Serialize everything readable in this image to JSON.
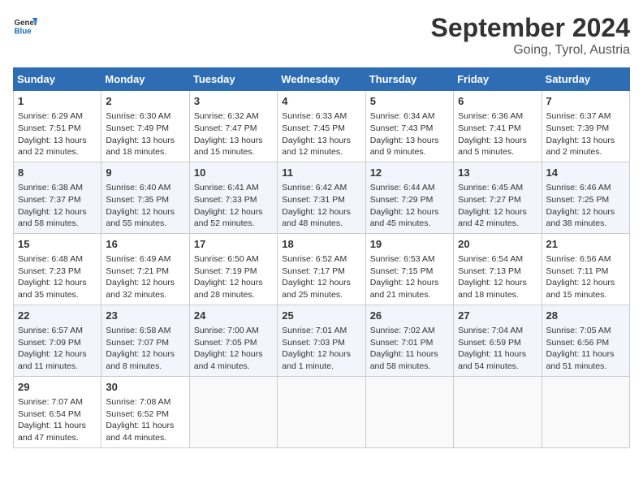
{
  "header": {
    "logo_line1": "General",
    "logo_line2": "Blue",
    "month": "September 2024",
    "location": "Going, Tyrol, Austria"
  },
  "weekdays": [
    "Sunday",
    "Monday",
    "Tuesday",
    "Wednesday",
    "Thursday",
    "Friday",
    "Saturday"
  ],
  "weeks": [
    [
      {
        "day": "1",
        "info": "Sunrise: 6:29 AM\nSunset: 7:51 PM\nDaylight: 13 hours\nand 22 minutes."
      },
      {
        "day": "2",
        "info": "Sunrise: 6:30 AM\nSunset: 7:49 PM\nDaylight: 13 hours\nand 18 minutes."
      },
      {
        "day": "3",
        "info": "Sunrise: 6:32 AM\nSunset: 7:47 PM\nDaylight: 13 hours\nand 15 minutes."
      },
      {
        "day": "4",
        "info": "Sunrise: 6:33 AM\nSunset: 7:45 PM\nDaylight: 13 hours\nand 12 minutes."
      },
      {
        "day": "5",
        "info": "Sunrise: 6:34 AM\nSunset: 7:43 PM\nDaylight: 13 hours\nand 9 minutes."
      },
      {
        "day": "6",
        "info": "Sunrise: 6:36 AM\nSunset: 7:41 PM\nDaylight: 13 hours\nand 5 minutes."
      },
      {
        "day": "7",
        "info": "Sunrise: 6:37 AM\nSunset: 7:39 PM\nDaylight: 13 hours\nand 2 minutes."
      }
    ],
    [
      {
        "day": "8",
        "info": "Sunrise: 6:38 AM\nSunset: 7:37 PM\nDaylight: 12 hours\nand 58 minutes."
      },
      {
        "day": "9",
        "info": "Sunrise: 6:40 AM\nSunset: 7:35 PM\nDaylight: 12 hours\nand 55 minutes."
      },
      {
        "day": "10",
        "info": "Sunrise: 6:41 AM\nSunset: 7:33 PM\nDaylight: 12 hours\nand 52 minutes."
      },
      {
        "day": "11",
        "info": "Sunrise: 6:42 AM\nSunset: 7:31 PM\nDaylight: 12 hours\nand 48 minutes."
      },
      {
        "day": "12",
        "info": "Sunrise: 6:44 AM\nSunset: 7:29 PM\nDaylight: 12 hours\nand 45 minutes."
      },
      {
        "day": "13",
        "info": "Sunrise: 6:45 AM\nSunset: 7:27 PM\nDaylight: 12 hours\nand 42 minutes."
      },
      {
        "day": "14",
        "info": "Sunrise: 6:46 AM\nSunset: 7:25 PM\nDaylight: 12 hours\nand 38 minutes."
      }
    ],
    [
      {
        "day": "15",
        "info": "Sunrise: 6:48 AM\nSunset: 7:23 PM\nDaylight: 12 hours\nand 35 minutes."
      },
      {
        "day": "16",
        "info": "Sunrise: 6:49 AM\nSunset: 7:21 PM\nDaylight: 12 hours\nand 32 minutes."
      },
      {
        "day": "17",
        "info": "Sunrise: 6:50 AM\nSunset: 7:19 PM\nDaylight: 12 hours\nand 28 minutes."
      },
      {
        "day": "18",
        "info": "Sunrise: 6:52 AM\nSunset: 7:17 PM\nDaylight: 12 hours\nand 25 minutes."
      },
      {
        "day": "19",
        "info": "Sunrise: 6:53 AM\nSunset: 7:15 PM\nDaylight: 12 hours\nand 21 minutes."
      },
      {
        "day": "20",
        "info": "Sunrise: 6:54 AM\nSunset: 7:13 PM\nDaylight: 12 hours\nand 18 minutes."
      },
      {
        "day": "21",
        "info": "Sunrise: 6:56 AM\nSunset: 7:11 PM\nDaylight: 12 hours\nand 15 minutes."
      }
    ],
    [
      {
        "day": "22",
        "info": "Sunrise: 6:57 AM\nSunset: 7:09 PM\nDaylight: 12 hours\nand 11 minutes."
      },
      {
        "day": "23",
        "info": "Sunrise: 6:58 AM\nSunset: 7:07 PM\nDaylight: 12 hours\nand 8 minutes."
      },
      {
        "day": "24",
        "info": "Sunrise: 7:00 AM\nSunset: 7:05 PM\nDaylight: 12 hours\nand 4 minutes."
      },
      {
        "day": "25",
        "info": "Sunrise: 7:01 AM\nSunset: 7:03 PM\nDaylight: 12 hours\nand 1 minute."
      },
      {
        "day": "26",
        "info": "Sunrise: 7:02 AM\nSunset: 7:01 PM\nDaylight: 11 hours\nand 58 minutes."
      },
      {
        "day": "27",
        "info": "Sunrise: 7:04 AM\nSunset: 6:59 PM\nDaylight: 11 hours\nand 54 minutes."
      },
      {
        "day": "28",
        "info": "Sunrise: 7:05 AM\nSunset: 6:56 PM\nDaylight: 11 hours\nand 51 minutes."
      }
    ],
    [
      {
        "day": "29",
        "info": "Sunrise: 7:07 AM\nSunset: 6:54 PM\nDaylight: 11 hours\nand 47 minutes."
      },
      {
        "day": "30",
        "info": "Sunrise: 7:08 AM\nSunset: 6:52 PM\nDaylight: 11 hours\nand 44 minutes."
      },
      {
        "day": "",
        "info": ""
      },
      {
        "day": "",
        "info": ""
      },
      {
        "day": "",
        "info": ""
      },
      {
        "day": "",
        "info": ""
      },
      {
        "day": "",
        "info": ""
      }
    ]
  ]
}
